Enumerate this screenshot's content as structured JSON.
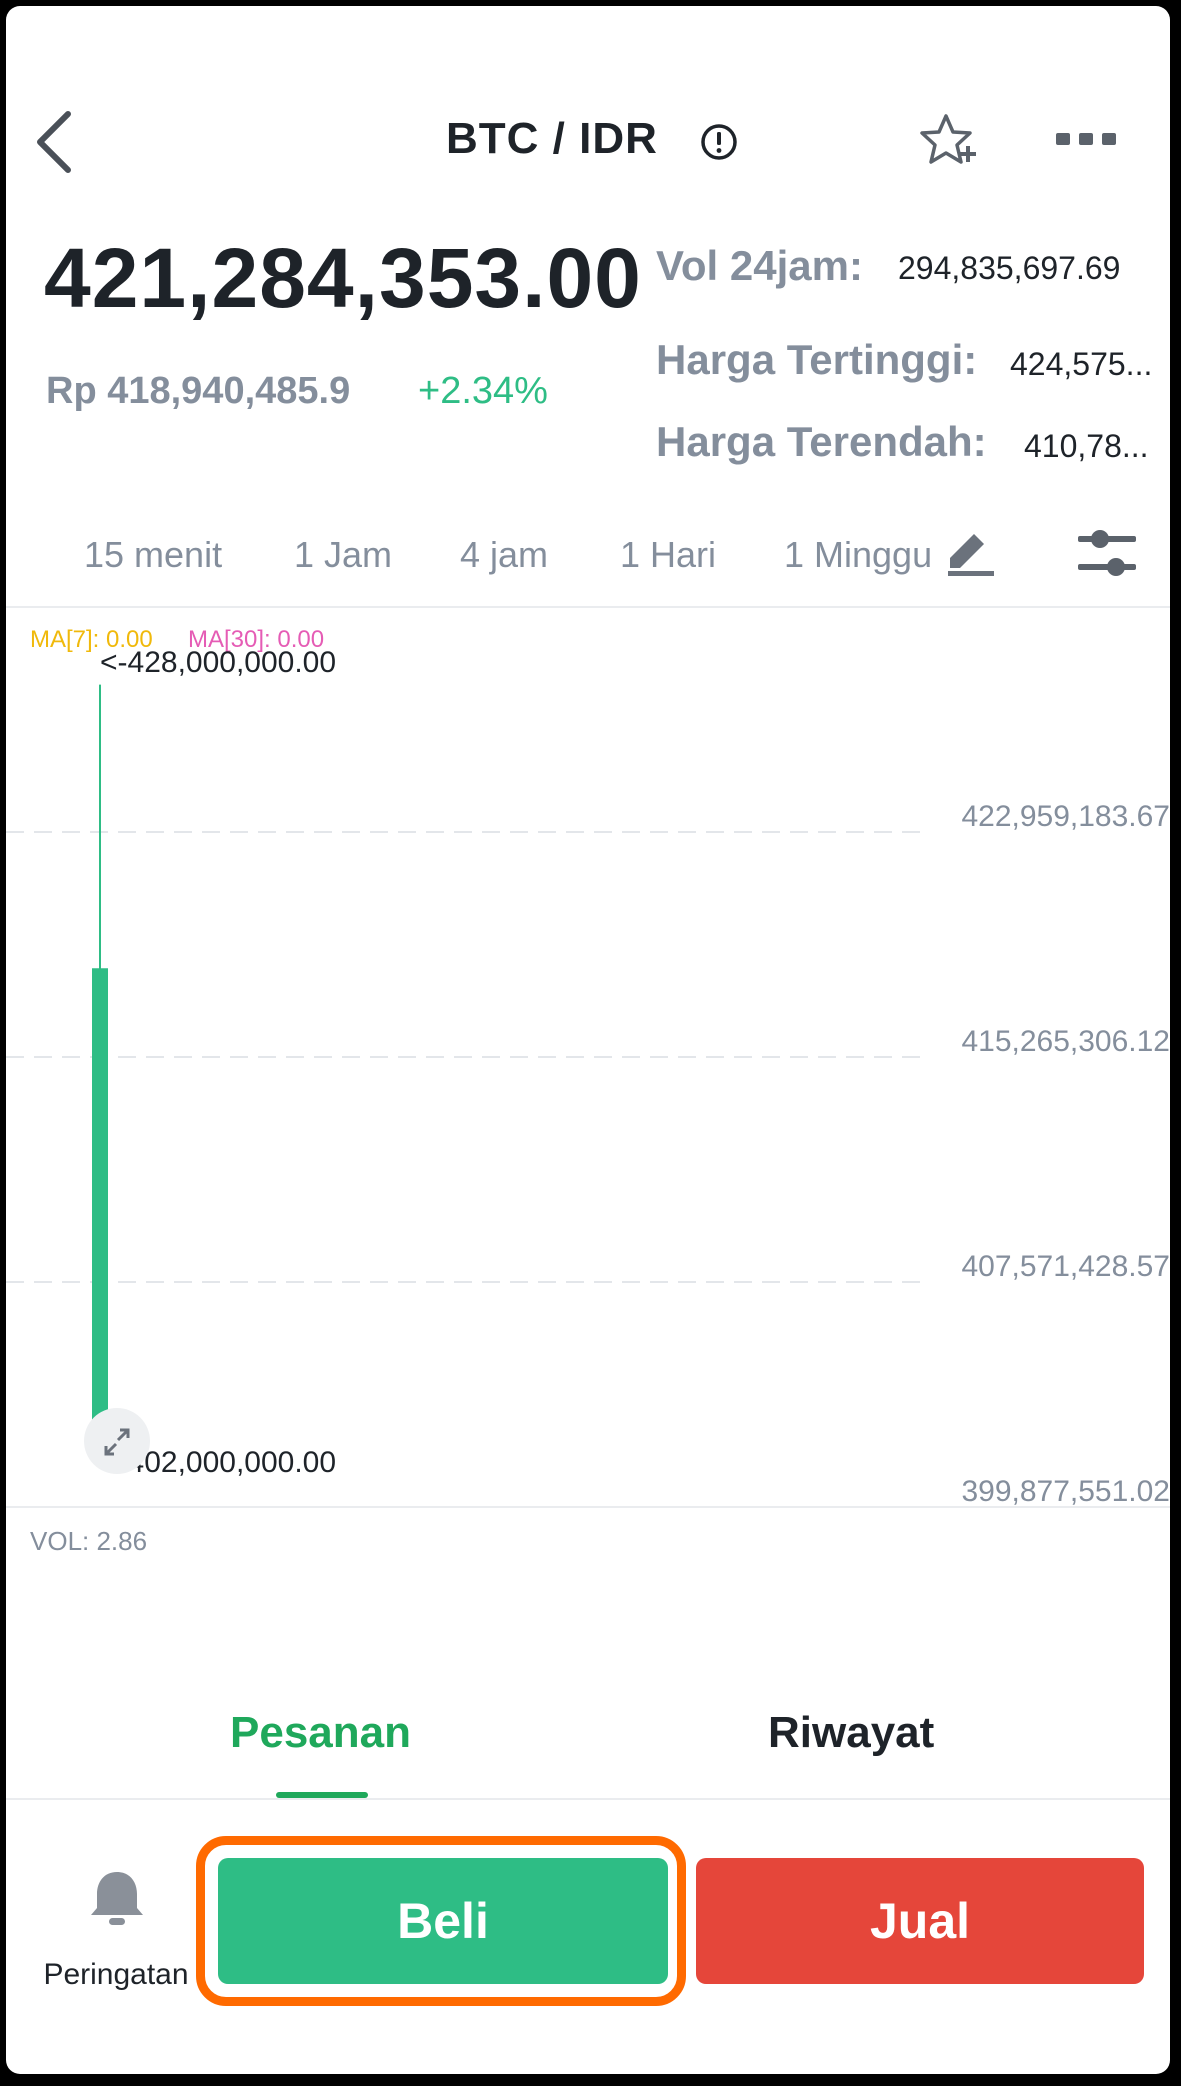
{
  "header": {
    "pair": "BTC / IDR",
    "back_icon": "chevron-left-icon",
    "info_icon": "info-circle-icon",
    "favorite_icon": "star-plus-icon",
    "more_icon": "more-dots-icon"
  },
  "price": {
    "last": "421,284,353.00",
    "fiat": "Rp 418,940,485.9",
    "change": "+2.34%",
    "change_color": "#2ebd85"
  },
  "stats": [
    {
      "label": "Vol 24jam:",
      "value": "294,835,697.69"
    },
    {
      "label": "Harga Tertinggi:",
      "value": "424,575..."
    },
    {
      "label": "Harga Terendah:",
      "value": "410,78..."
    }
  ],
  "intervals": [
    "15 menit",
    "1 Jam",
    "4 jam",
    "1 Hari",
    "1 Minggu"
  ],
  "chart_tools": {
    "draw_icon": "pencil-icon",
    "settings_icon": "sliders-icon"
  },
  "chart_data": {
    "type": "candlestick",
    "indicators": {
      "ma7": "MA[7]: 0.00",
      "ma30": "MA[30]: 0.00"
    },
    "high_label": "<-428,000,000.00",
    "low_label": "<-402,000,000.00",
    "y_ticks": [
      "422,959,183.67",
      "415,265,306.12",
      "407,571,428.57",
      "399,877,551.02"
    ],
    "y_tick_values": [
      422959183.67,
      415265306.12,
      407571428.57,
      399877551.02
    ],
    "candles": [
      {
        "open": 402800000,
        "close": 418300000,
        "high": 428000000,
        "low": 402000000,
        "direction": "up"
      }
    ],
    "grid": true,
    "candle_up_color": "#2ebd85",
    "volume": "VOL: 2.86"
  },
  "order_tabs": {
    "active": "Pesanan",
    "other": "Riwayat"
  },
  "actions": {
    "alert_label": "Peringatan",
    "alert_icon": "bell-icon",
    "buy_label": "Beli",
    "sell_label": "Jual",
    "buy_color": "#2ebd85",
    "sell_color": "#e5463a",
    "highlight_color": "#ff6a00"
  }
}
